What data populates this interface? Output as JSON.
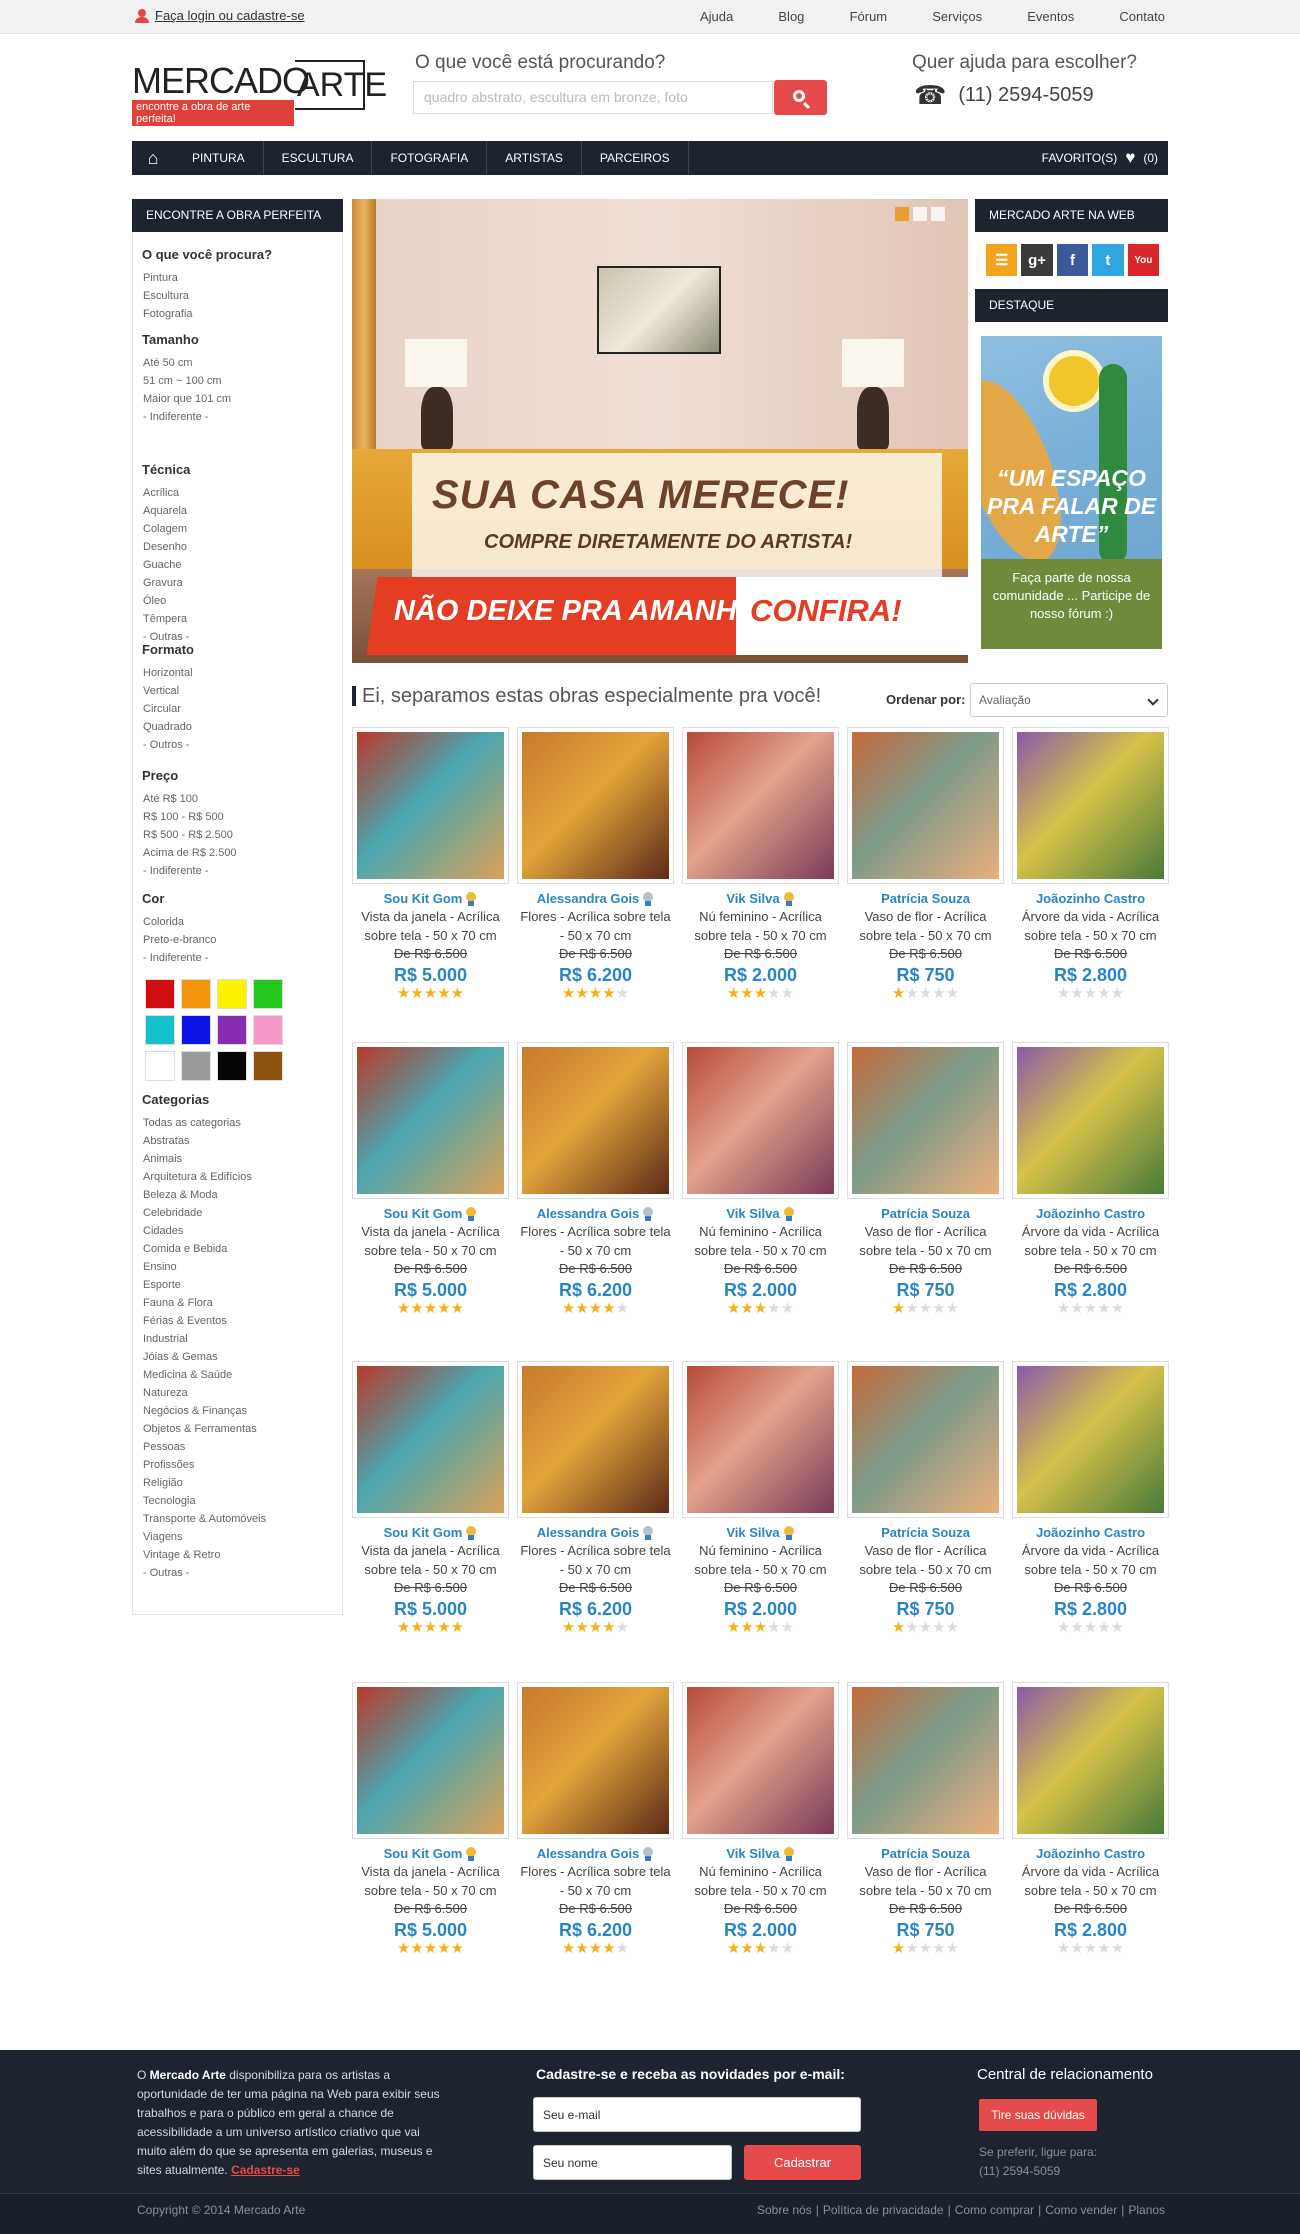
{
  "topbar": {
    "login": "Faça login ou cadastre-se",
    "links": [
      "Ajuda",
      "Blog",
      "Fórum",
      "Serviços",
      "Eventos",
      "Contato"
    ]
  },
  "header": {
    "logo_main": "MERCADO",
    "logo_box": "ARTE",
    "logo_tagline": "encontre a obra de arte perfeita!",
    "search_label": "O que você está procurando?",
    "search_placeholder": "quadro abstrato, escultura em bronze, foto",
    "help_label": "Quer ajuda para escolher?",
    "phone": "(11) 2594-5059"
  },
  "nav": {
    "items": [
      "PINTURA",
      "ESCULTURA",
      "FOTOGRAFIA",
      "ARTISTAS",
      "PARCEIROS"
    ],
    "favorites_label": "FAVORITO(S)",
    "favorites_count": "(0)"
  },
  "sidebar": {
    "title": "ENCONTRE A OBRA PERFEITA",
    "sections": [
      {
        "title": "O que você procura?",
        "items": [
          "Pintura",
          "Escultura",
          "Fotografia"
        ]
      },
      {
        "title": "Tamanho",
        "items": [
          "Até 50 cm",
          "51 cm ~ 100 cm",
          "Maior que 101 cm",
          "- Indiferente -"
        ]
      },
      {
        "title": "Técnica",
        "items": [
          "Acrílica",
          "Aquarela",
          "Colagem",
          "Desenho",
          "Guache",
          "Gravura",
          "Óleo",
          "Têmpera",
          "- Outras -"
        ]
      },
      {
        "title": "Formato",
        "items": [
          "Horizontal",
          "Vertical",
          "Circular",
          "Quadrado",
          "- Outros -"
        ]
      },
      {
        "title": "Preço",
        "items": [
          "Até R$ 100",
          "R$ 100 - R$ 500",
          "R$ 500 - R$ 2.500",
          "Acima de R$ 2.500",
          "- Indiferente -"
        ]
      },
      {
        "title": "Cor",
        "items": [
          "Colorida",
          "Preto-e-branco",
          "- Indiferente -"
        ]
      },
      {
        "title": "Categorias",
        "items": [
          "Todas as categorias",
          "Abstratas",
          "Animais",
          "Arquitetura & Edifícios",
          "Beleza & Moda",
          "Celebridade",
          "Cidades",
          "Comida e Bebida",
          "Ensino",
          "Esporte",
          "Fauna & Flora",
          "Férias & Eventos",
          "Industrial",
          "Jóias & Gemas",
          "Medicina & Saúde",
          "Natureza",
          "Negócios & Finanças",
          "Objetos & Ferramentas",
          "Pessoas",
          "Profissões",
          "Religião",
          "Tecnologia",
          "Transporte & Automóveis",
          "Viagens",
          "Vintage & Retro",
          "- Outras -"
        ]
      }
    ],
    "swatch_colors": [
      "#d01010",
      "#f2940c",
      "#fff200",
      "#22c81e",
      "#12c2c8",
      "#0a14e6",
      "#8a2bb4",
      "#f59ac8",
      "#ffffff",
      "#9a9a9a",
      "#050505",
      "#8a5410"
    ]
  },
  "banner": {
    "headline": "SUA CASA MERECE!",
    "subheadline": "COMPRE DIRETAMENTE DO ARTISTA!",
    "cta_left": "NÃO DEIXE PRA AMANHÃ.",
    "cta_right": "CONFIRA!"
  },
  "right_sidebar": {
    "web_title": "MERCADO ARTE NA WEB",
    "social": [
      {
        "icon": "rss-icon",
        "glyph": "☰",
        "color": "#f2a51a"
      },
      {
        "icon": "google-plus-icon",
        "glyph": "g+",
        "color": "#3a3a3a"
      },
      {
        "icon": "facebook-icon",
        "glyph": "f",
        "color": "#3b5a9a"
      },
      {
        "icon": "twitter-icon",
        "glyph": "t",
        "color": "#2fa6e0"
      },
      {
        "icon": "youtube-icon",
        "glyph": "You",
        "color": "#d8262a"
      }
    ],
    "destaque_title": "DESTAQUE",
    "destaque_quote": "“UM ESPAÇO PRA FALAR DE ARTE”",
    "destaque_text": "Faça parte de nossa comunidade ... Participe de nosso fórum :)"
  },
  "products_section": {
    "heading": "Ei, separamos estas obras especialmente pra você!",
    "sort_label": "Ordenar por:",
    "sort_value": "Avaliação",
    "products": [
      {
        "artist": "Sou Kit Gom",
        "medal": "gold",
        "title": "Vista da janela - Acrílica sobre tela - 50 x 70 cm",
        "old_price": "De R$ 6.500",
        "price": "R$ 5.000",
        "rating": 5
      },
      {
        "artist": "Alessandra Gois",
        "medal": "silver",
        "title": "Flores - Acrílica sobre tela - 50 x 70 cm",
        "old_price": "De R$ 6.500",
        "price": "R$ 6.200",
        "rating": 4
      },
      {
        "artist": "Vik Silva",
        "medal": "gold",
        "title": "Nú feminino - Acrílica sobre tela - 50 x 70 cm",
        "old_price": "De R$ 6.500",
        "price": "R$ 2.000",
        "rating": 3
      },
      {
        "artist": "Patrícia Souza",
        "medal": "",
        "title": "Vaso de flor - Acrílica sobre tela - 50 x 70 cm",
        "old_price": "De R$ 6.500",
        "price": "R$ 750",
        "rating": 1
      },
      {
        "artist": "Joãozinho Castro",
        "medal": "",
        "title": "Árvore da vida - Acrílica sobre tela - 50 x 70 cm",
        "old_price": "De R$ 6.500",
        "price": "R$ 2.800",
        "rating": 0
      }
    ],
    "thumb_colors": [
      [
        "#b73a2a",
        "#4aa6b0",
        "#d9a25a"
      ],
      [
        "#c87a2c",
        "#e3a43a",
        "#5b2a18"
      ],
      [
        "#b84a3a",
        "#e2a28a",
        "#7a3a5a"
      ],
      [
        "#c56a3a",
        "#7e9a8a",
        "#e8b07a"
      ],
      [
        "#8a5aa8",
        "#d7c24a",
        "#4a7a3a"
      ]
    ]
  },
  "footer": {
    "about_pre": "O ",
    "about_brand": "Mercado Arte",
    "about_text": " disponibiliza para os artistas a oportunidade de ter uma página na Web para exibir seus trabalhos e para o público em geral a chance de acessibilidade a um universo artístico criativo que vai muito além do que se apresenta em galerias, museus e sites atualmente. ",
    "about_link": "Cadastre-se",
    "newsletter_title": "Cadastre-se e receba as novidades por e-mail:",
    "email_placeholder": "Seu e-mail",
    "name_placeholder": "Seu nome",
    "submit_label": "Cadastrar",
    "support_title": "Central de relacionamento",
    "support_button": "Tire suas dúvidas",
    "call_label": "Se preferir, ligue para:",
    "call_phone": "(11) 2594-5059",
    "copyright": "Copyright © 2014 Mercado Arte",
    "links": [
      "Sobre nós",
      "Política de privacidade",
      "Como comprar",
      "Como vender",
      "Planos"
    ]
  }
}
